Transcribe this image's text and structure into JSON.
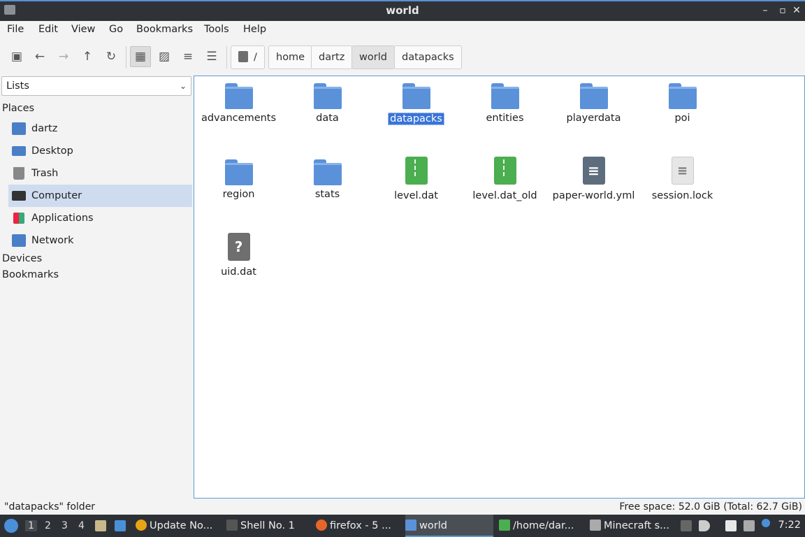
{
  "window": {
    "title": "world"
  },
  "menu": [
    "File",
    "Edit",
    "View",
    "Go",
    "Bookmarks",
    "Tools",
    "Help"
  ],
  "breadcrumb": [
    "/",
    "home",
    "dartz",
    "world",
    "datapacks"
  ],
  "sidebar": {
    "select_value": "Lists",
    "places_label": "Places",
    "places": [
      "dartz",
      "Desktop",
      "Trash",
      "Computer",
      "Applications",
      "Network"
    ],
    "devices_label": "Devices",
    "bookmarks_label": "Bookmarks"
  },
  "files": [
    {
      "name": "advancements",
      "kind": "folder"
    },
    {
      "name": "data",
      "kind": "folder"
    },
    {
      "name": "datapacks",
      "kind": "folder"
    },
    {
      "name": "entities",
      "kind": "folder"
    },
    {
      "name": "playerdata",
      "kind": "folder"
    },
    {
      "name": "poi",
      "kind": "folder"
    },
    {
      "name": "region",
      "kind": "folder"
    },
    {
      "name": "stats",
      "kind": "folder"
    },
    {
      "name": "level.dat",
      "kind": "archive"
    },
    {
      "name": "level.dat_old",
      "kind": "archive"
    },
    {
      "name": "paper-world.yml",
      "kind": "text"
    },
    {
      "name": "session.lock",
      "kind": "plain"
    },
    {
      "name": "uid.dat",
      "kind": "unknown"
    }
  ],
  "status": {
    "left": "\"datapacks\" folder",
    "right": "Free space: 52.0 GiB (Total: 62.7 GiB)"
  },
  "taskbar": {
    "workspaces": [
      "1",
      "2",
      "3",
      "4"
    ],
    "tasks": [
      "Update No...",
      "Shell No. 1",
      "firefox - 5 ...",
      "world",
      "/home/dar...",
      "Minecraft s..."
    ],
    "clock": "7:22"
  },
  "colors": {
    "accent": "#3874d8",
    "folder": "#5b91d8",
    "archive": "#4bae4f",
    "taskbar": "#2d3136"
  }
}
